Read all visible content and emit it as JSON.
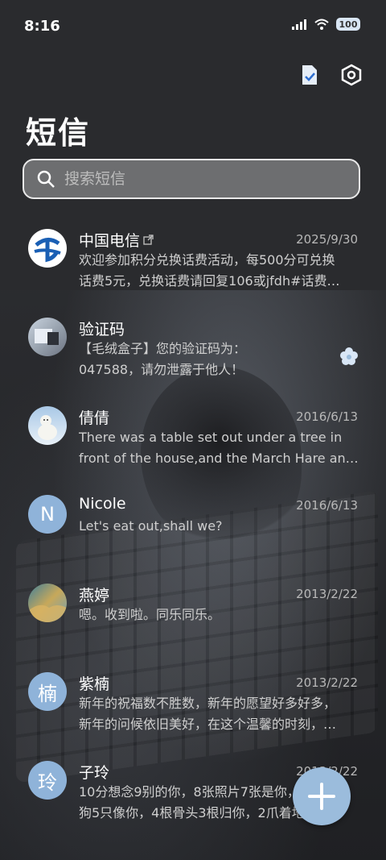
{
  "status_bar": {
    "time": "8:16",
    "battery": "100"
  },
  "header": {
    "title": "短信"
  },
  "search": {
    "placeholder": "搜索短信"
  },
  "colors": {
    "fab": "#9bbcdc",
    "avatar_blue": "#8fb3d9",
    "telecom_blue": "#1a5fb4"
  },
  "conversations": [
    {
      "name": "中国电信",
      "date": "2025/9/30",
      "line1": "欢迎参加积分兑换话费活动，每500分可兑换",
      "line2": "话费5元，兑换话费请回复106或jfdh#话费…",
      "avatar": "china-telecom-logo"
    },
    {
      "name": "验证码",
      "date": "",
      "line1": "【毛绒盒子】您的验证码为：",
      "line2": "047588，请勿泄露于他人！",
      "avatar": "photo"
    },
    {
      "name": "倩倩",
      "date": "2016/6/13",
      "line1": "There was a table set out under a tree in",
      "line2": "front of the house,and the March Hare an…",
      "avatar": "polar-bear-photo"
    },
    {
      "name": "Nicole",
      "date": "2016/6/13",
      "line1": "Let's eat out,shall we?",
      "line2": "",
      "avatar_letter": "N"
    },
    {
      "name": "燕婷",
      "date": "2013/2/22",
      "line1": "嗯。收到啦。同乐同乐。",
      "line2": "",
      "avatar": "landscape-photo"
    },
    {
      "name": "紫楠",
      "date": "2013/2/22",
      "line1": "新年的祝福数不胜数，新年的愿望好多好多，",
      "line2": "新年的问候依旧美好，在这个温馨的时刻，…",
      "avatar_letter": "楠"
    },
    {
      "name": "子玲",
      "date": "2013/2/22",
      "line1": "10分想念9别的你，8张照片7张是你，6只小",
      "line2": "狗5只像你，4根骨头3根归你，2爪着地1宗…",
      "avatar_letter": "玲"
    }
  ]
}
